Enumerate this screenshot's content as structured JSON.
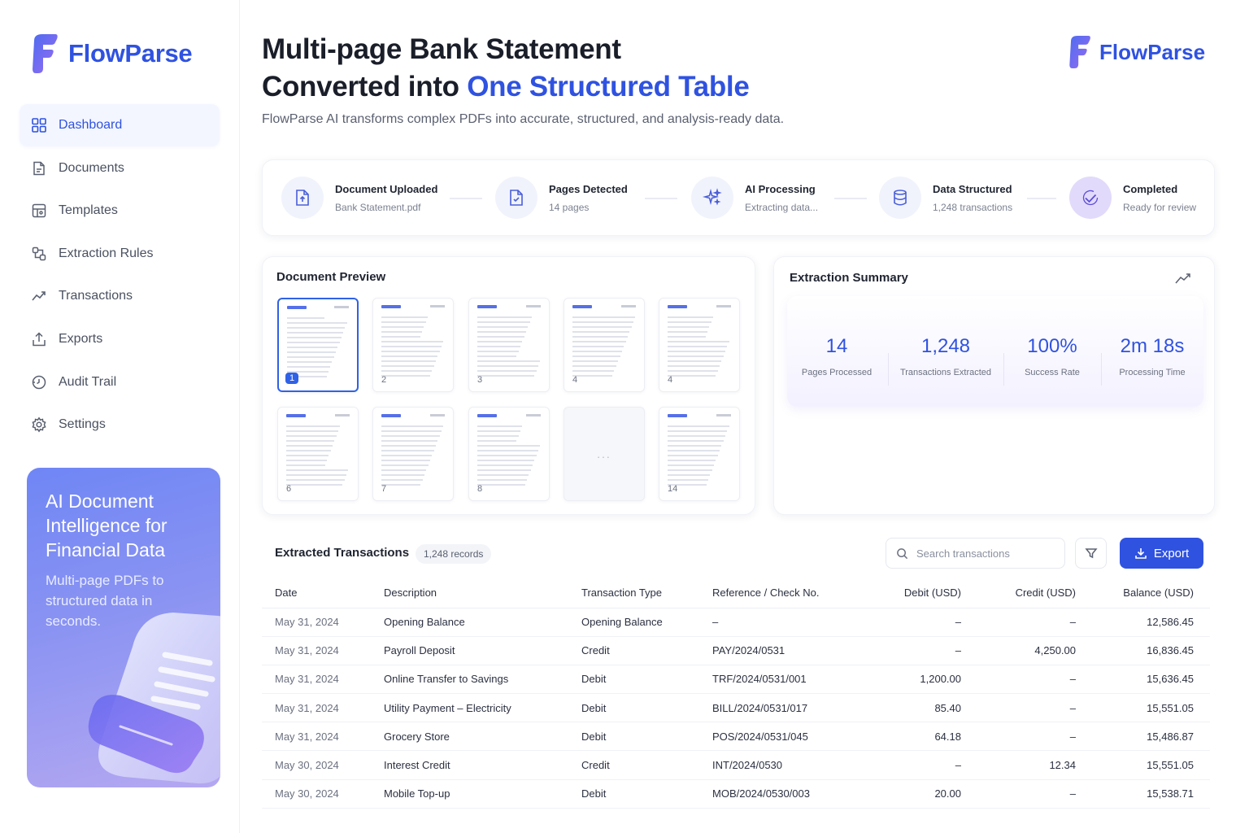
{
  "brand": {
    "name": "FlowParse"
  },
  "sidebar": {
    "items": [
      {
        "label": "Dashboard",
        "icon": "dashboard-icon",
        "active": true
      },
      {
        "label": "Documents",
        "icon": "document-icon"
      },
      {
        "label": "Templates",
        "icon": "templates-icon"
      },
      {
        "label": "Extraction Rules",
        "icon": "rules-icon"
      },
      {
        "label": "Transactions",
        "icon": "trend-icon"
      },
      {
        "label": "Exports",
        "icon": "upload-icon"
      },
      {
        "label": "Audit Trail",
        "icon": "history-icon"
      },
      {
        "label": "Settings",
        "icon": "gear-icon"
      }
    ],
    "promo": {
      "title": "AI Document Intelligence for Financial Data",
      "text": "Multi-page PDFs to structured data in seconds."
    }
  },
  "header": {
    "title_line1": "Multi-page Bank Statement",
    "title_line2_prefix": "Converted into ",
    "title_line2_accent": "One Structured Table",
    "subtitle": "FlowParse AI transforms complex PDFs into accurate, structured, and analysis-ready data."
  },
  "pipeline": [
    {
      "title": "Document Uploaded",
      "detail": "Bank Statement.pdf",
      "icon": "file-upload-icon"
    },
    {
      "title": "Pages Detected",
      "detail": "14 pages",
      "icon": "pages-icon"
    },
    {
      "title": "AI Processing",
      "detail": "Extracting data...",
      "icon": "sparkle-icon"
    },
    {
      "title": "Data Structured",
      "detail": "1,248 transactions",
      "icon": "database-icon"
    },
    {
      "title": "Completed",
      "detail": "Ready for review",
      "icon": "check-icon"
    }
  ],
  "preview": {
    "title": "Document Preview",
    "pages": [
      "1",
      "2",
      "3",
      "4",
      "4",
      "6",
      "7",
      "8",
      "...",
      "14"
    ],
    "selected_page": "1"
  },
  "summary": {
    "title": "Extraction Summary",
    "stats": [
      {
        "value": "14",
        "label": "Pages Processed"
      },
      {
        "value": "1,248",
        "label": "Transactions Extracted"
      },
      {
        "value": "100%",
        "label": "Success Rate"
      },
      {
        "value": "2m 18s",
        "label": "Processing Time"
      }
    ]
  },
  "transactions": {
    "title": "Extracted Transactions",
    "count": "1,248 records",
    "search_placeholder": "Search transactions",
    "export_label": "Export",
    "columns": [
      "Date",
      "Description",
      "Transaction Type",
      "Reference / Check No.",
      "Debit (USD)",
      "Credit (USD)",
      "Balance (USD)"
    ],
    "rows": [
      [
        "May 31, 2024",
        "Opening Balance",
        "Opening Balance",
        "–",
        "–",
        "–",
        "12,586.45"
      ],
      [
        "May 31, 2024",
        "Payroll Deposit",
        "Credit",
        "PAY/2024/0531",
        "–",
        "4,250.00",
        "16,836.45"
      ],
      [
        "May 31, 2024",
        "Online Transfer to Savings",
        "Debit",
        "TRF/2024/0531/001",
        "1,200.00",
        "–",
        "15,636.45"
      ],
      [
        "May 31, 2024",
        "Utility Payment – Electricity",
        "Debit",
        "BILL/2024/0531/017",
        "85.40",
        "–",
        "15,551.05"
      ],
      [
        "May 31, 2024",
        "Grocery Store",
        "Debit",
        "POS/2024/0531/045",
        "64.18",
        "–",
        "15,486.87"
      ],
      [
        "May 30, 2024",
        "Interest Credit",
        "Credit",
        "INT/2024/0530",
        "–",
        "12.34",
        "15,551.05"
      ],
      [
        "May 30, 2024",
        "Mobile Top-up",
        "Debit",
        "MOB/2024/0530/003",
        "20.00",
        "–",
        "15,538.71"
      ]
    ]
  },
  "colors": {
    "accent": "#2f52e0",
    "promo_start": "#6f86f5",
    "promo_end": "#b5a8f1"
  }
}
